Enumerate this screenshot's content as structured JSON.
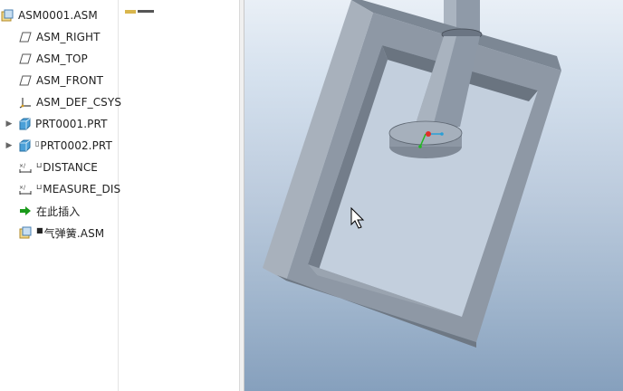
{
  "model_tree": {
    "items": [
      {
        "label": "ASM0001.ASM",
        "icon": "assembly-icon",
        "prefix": "",
        "expander": ""
      },
      {
        "label": "ASM_RIGHT",
        "icon": "datum-plane-icon",
        "prefix": "",
        "expander": ""
      },
      {
        "label": "ASM_TOP",
        "icon": "datum-plane-icon",
        "prefix": "",
        "expander": ""
      },
      {
        "label": "ASM_FRONT",
        "icon": "datum-plane-icon",
        "prefix": "",
        "expander": ""
      },
      {
        "label": "ASM_DEF_CSYS",
        "icon": "csys-icon",
        "prefix": "",
        "expander": ""
      },
      {
        "label": "PRT0001.PRT",
        "icon": "part-icon",
        "prefix": "",
        "expander": "▶"
      },
      {
        "label": "PRT0002.PRT",
        "icon": "part-icon",
        "prefix": "▯",
        "expander": "▶"
      },
      {
        "label": "DISTANCE",
        "icon": "measure-icon",
        "prefix": "⊔",
        "expander": ""
      },
      {
        "label": "MEASURE_DIS",
        "icon": "measure-icon",
        "prefix": "⊔",
        "expander": ""
      },
      {
        "label": "在此插入",
        "icon": "insert-here-arrow-icon",
        "prefix": "",
        "expander": ""
      },
      {
        "label": "气弹簧.ASM",
        "icon": "assembly-icon",
        "prefix": "■",
        "expander": ""
      }
    ]
  },
  "viewport": {
    "background_top": "#e9eff6",
    "background_bottom": "#86a0bd",
    "model_color": "#8e98a5"
  },
  "colors": {
    "accent_green": "#1a9a1a",
    "csys_orange": "#d8a020",
    "part_blue": "#4aa0d8"
  }
}
